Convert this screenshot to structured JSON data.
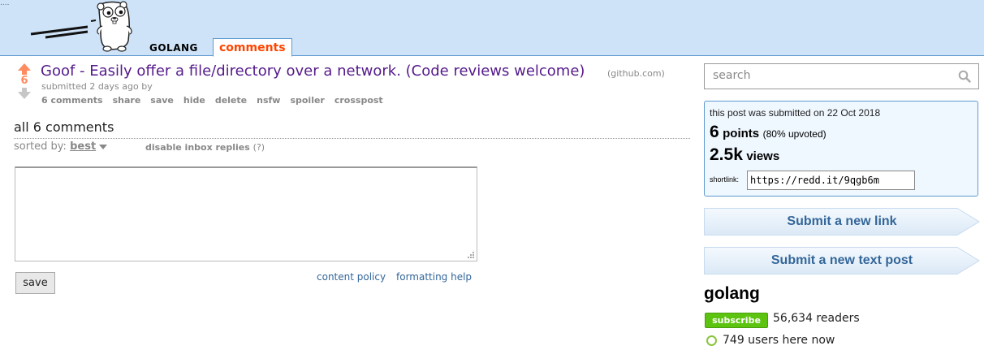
{
  "header": {
    "corner_dots": "....",
    "subreddit_name": "GOLANG",
    "active_tab": "comments",
    "colors": {
      "background": "#cee3f8",
      "tab_text": "#ff4500"
    },
    "logo_icon": "gopher-logo-icon"
  },
  "post": {
    "score": "6",
    "title": "Goof - Easily offer a file/directory over a network. (Code reviews welcome)",
    "domain": "(github.com)",
    "tagline": "submitted 2 days ago by",
    "buttons": [
      "6 comments",
      "share",
      "save",
      "hide",
      "delete",
      "nsfw",
      "spoiler",
      "crosspost"
    ],
    "colors": {
      "title": "#551a8b",
      "upvote": "#ff8b60",
      "downvote": "#c6c6c6"
    }
  },
  "comments": {
    "title": "all 6 comments",
    "sort_label": "sorted by:",
    "sort_value": "best",
    "disable_inbox": "disable inbox replies",
    "disable_inbox_help": "(?)",
    "comment_box_value": "",
    "save_label": "save",
    "content_policy": "content policy",
    "formatting_help": "formatting help"
  },
  "sidebar": {
    "search_placeholder": "search",
    "submitted_date": "this post was submitted on 22 Oct 2018",
    "points": "6",
    "points_word": "points",
    "upvoted": "(80% upvoted)",
    "views": "2.5k",
    "views_word": "views",
    "shortlink_label": "shortlink:",
    "shortlink_value": "https://redd.it/9qgb6m",
    "submit_link_label": "Submit a new link",
    "submit_text_label": "Submit a new text post",
    "subreddit_title": "golang",
    "subscribe_label": "subscribe",
    "readers": "56,634 readers",
    "online": "749 users here now",
    "colors": {
      "info_box": "#eff7ff",
      "subscribe": "#5cc410",
      "link": "#336699"
    }
  }
}
